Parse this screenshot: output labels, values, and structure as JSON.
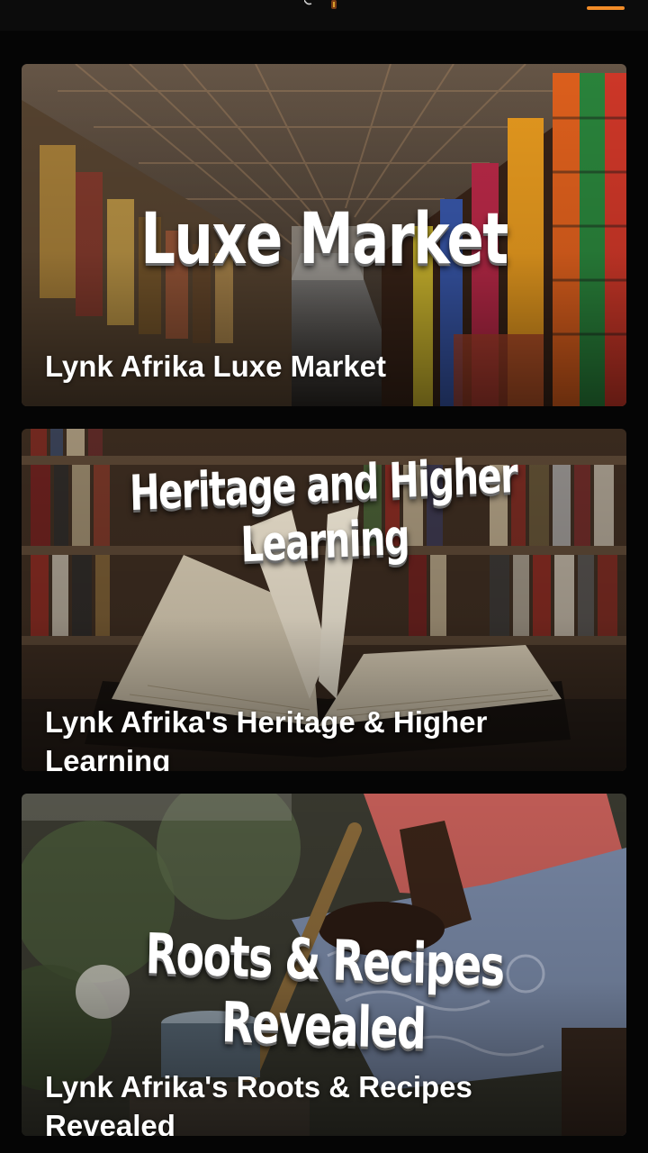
{
  "header": {
    "logo_icon": "lynk-afrika-logo-icon",
    "menu_icon": "hamburger-menu-icon",
    "accent_color": "#f28c28"
  },
  "cards": [
    {
      "banner": "Luxe Market",
      "title": "Lynk Afrika Luxe Market",
      "image_icon": "market-stalls-photo"
    },
    {
      "banner": "Heritage and Higher Learning",
      "title": "Lynk Afrika's Heritage & Higher Learning",
      "image_icon": "open-book-library-photo"
    },
    {
      "banner": "Roots & Recipes Revealed",
      "title": "Lynk Afrika's Roots & Recipes Revealed",
      "image_icon": "cooking-pot-photo"
    }
  ]
}
